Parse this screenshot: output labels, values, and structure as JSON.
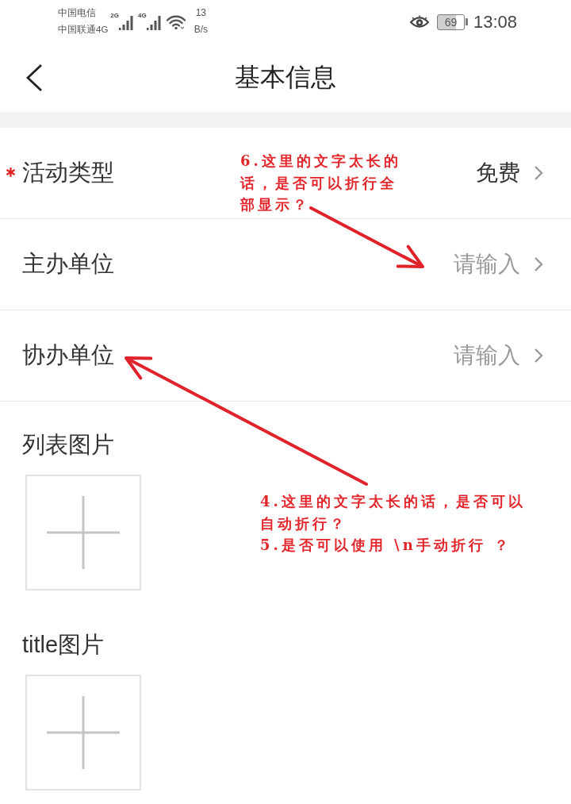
{
  "status_bar": {
    "carriers": [
      "中国电信",
      "中国联通4G"
    ],
    "signals": [
      {
        "label": "2G"
      },
      {
        "label": "4G"
      }
    ],
    "net_speed": {
      "value": "13",
      "unit": "B/s"
    },
    "battery": "69",
    "time": "13:08"
  },
  "header": {
    "title": "基本信息"
  },
  "form_rows": [
    {
      "label": "活动类型",
      "required": true,
      "value": "免费"
    },
    {
      "label": "主办单位",
      "required": false,
      "placeholder": "请输入"
    },
    {
      "label": "协办单位",
      "required": false,
      "placeholder": "请输入"
    }
  ],
  "image_fields": [
    {
      "label": "列表图片"
    },
    {
      "label": "title图片"
    }
  ],
  "annotations": [
    {
      "items": [
        "6.这里的文字太长的话，是否可以折行全部显示？"
      ]
    },
    {
      "items": [
        "4.这里的文字太长的话，是否可以自动折行？",
        "5.是否可以使用 \\n手动折行 ？"
      ]
    }
  ]
}
